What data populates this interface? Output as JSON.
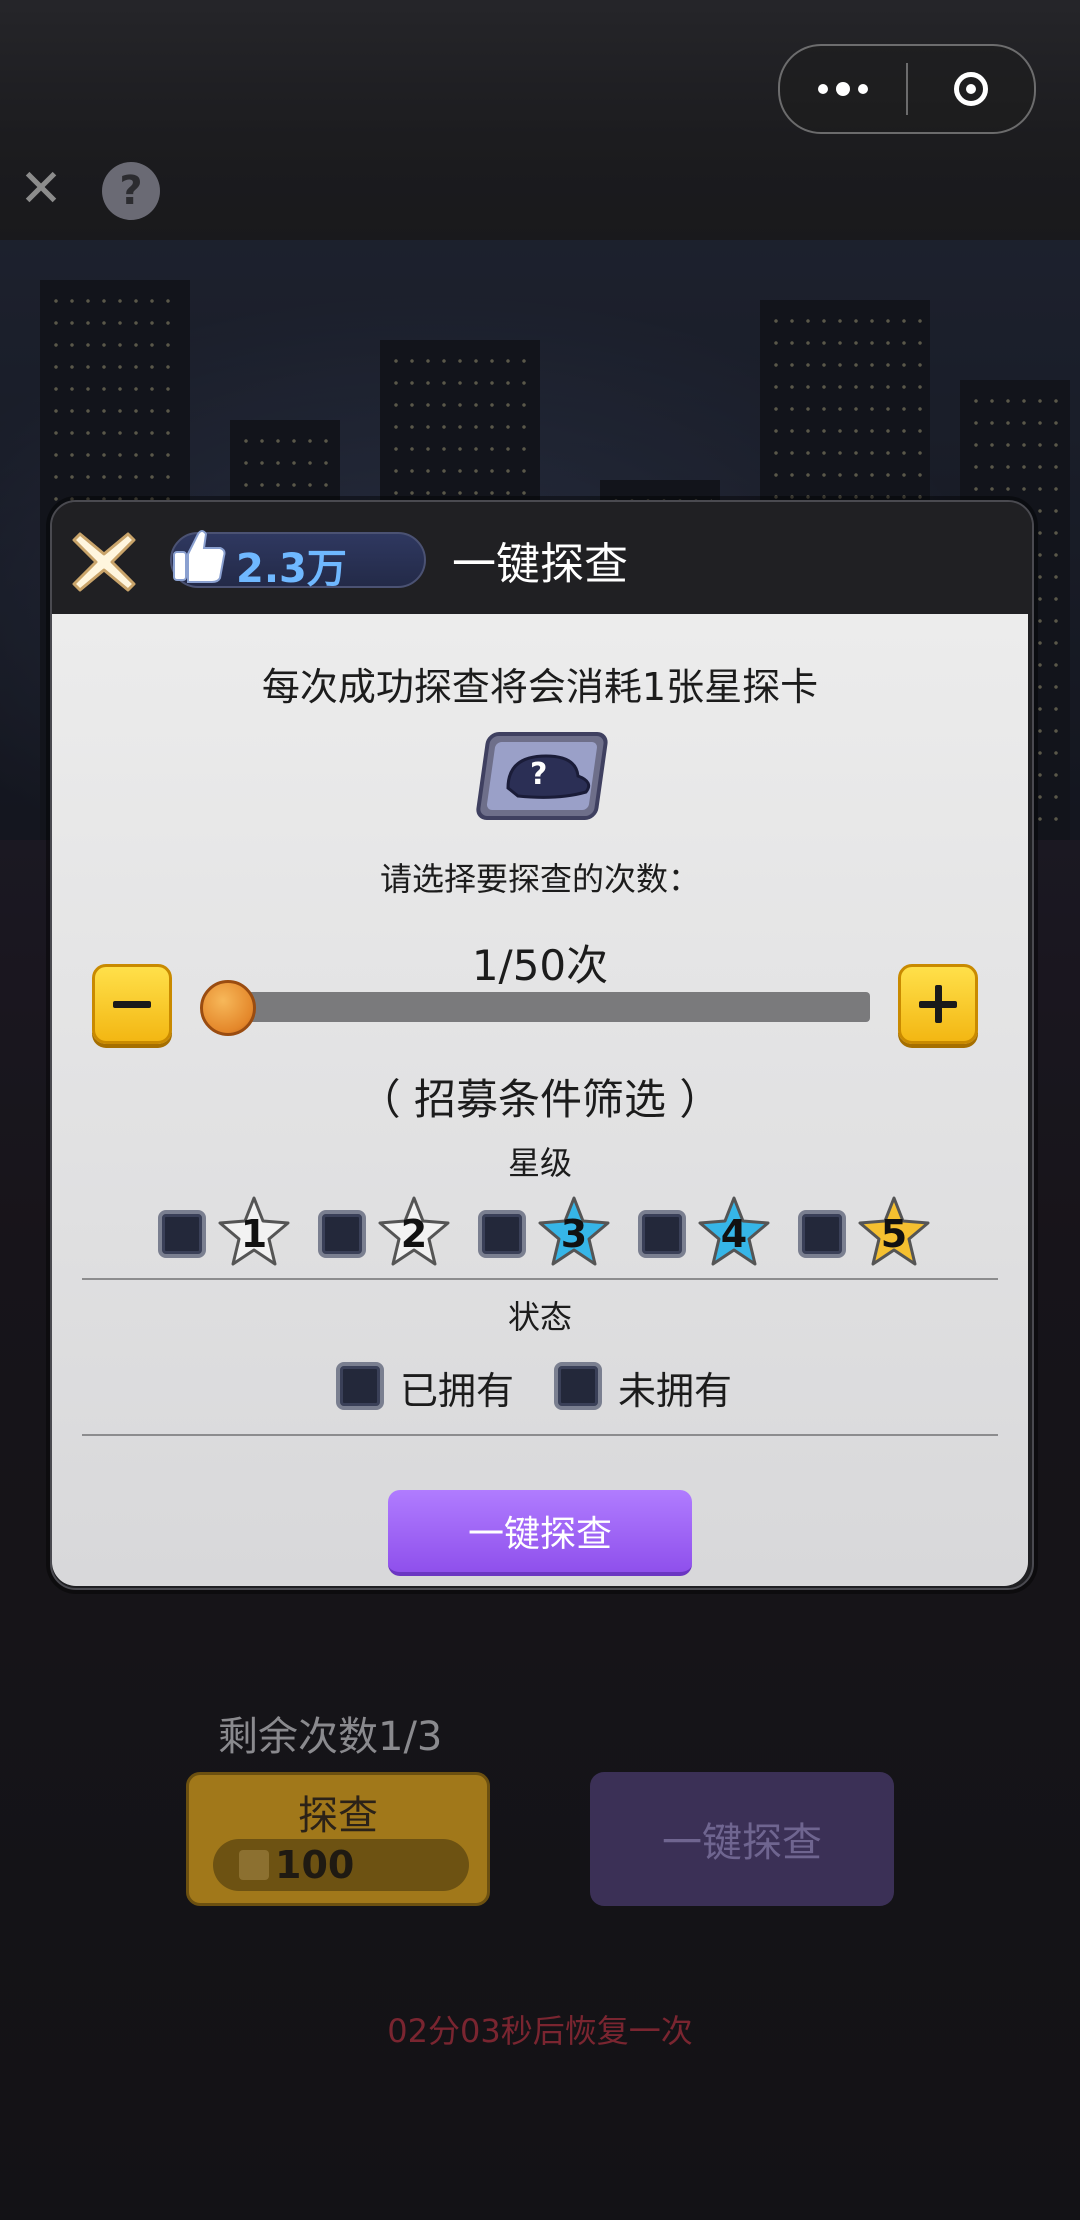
{
  "top_capsule": {
    "menu_icon": "more-dots-icon",
    "close_icon": "target-icon"
  },
  "background": {
    "remaining_label": "剩余次数1/3",
    "explore_button": {
      "label": "探查",
      "cost": "100"
    },
    "one_key_button": "一键探查",
    "recover_text": "02分03秒后恢复一次"
  },
  "modal": {
    "likes": "2.3万",
    "title": "一键探查",
    "notice": "每次成功探查将会消耗1张星探卡",
    "ask": "请选择要探查的次数：",
    "count_display": "1/50次",
    "count": {
      "current": 1,
      "max": 50
    },
    "filter_title": "（ 招募条件筛选 ）",
    "star_label": "星级",
    "stars": [
      {
        "value": "1",
        "color": "#f2f2f2"
      },
      {
        "value": "2",
        "color": "#f2f2f2"
      },
      {
        "value": "3",
        "color": "#36b6e8"
      },
      {
        "value": "4",
        "color": "#36b6e8"
      },
      {
        "value": "5",
        "color": "#f5c030"
      }
    ],
    "status_label": "状态",
    "status_options": [
      "已拥有",
      "未拥有"
    ],
    "confirm_button": "一键探查"
  },
  "colors": {
    "confirm_purple": "#9a5cf2",
    "stepper_yellow": "#f7c520",
    "likes_blue": "#6fb8ff"
  }
}
